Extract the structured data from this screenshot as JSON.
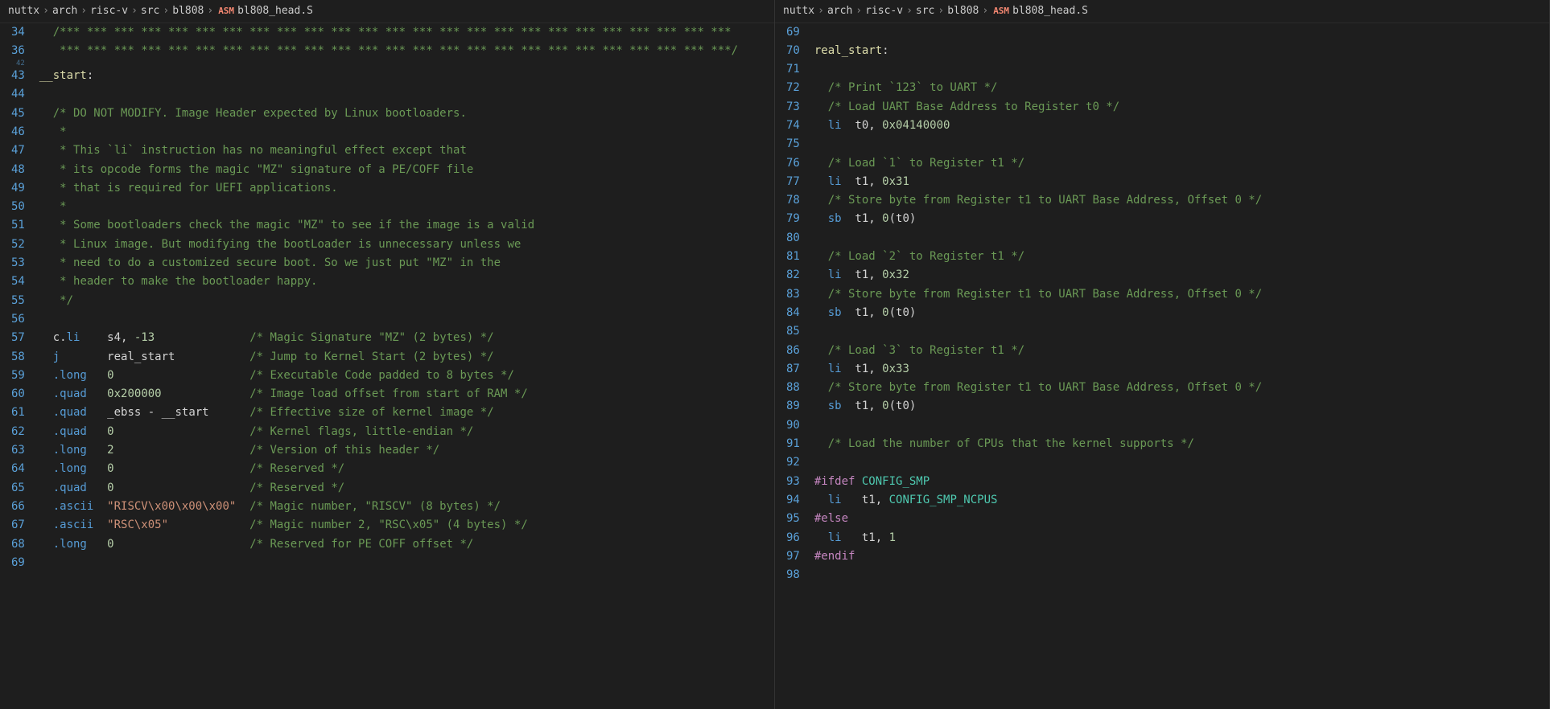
{
  "breadcrumbs": {
    "segments": [
      "nuttx",
      "arch",
      "risc-v",
      "src",
      "bl808"
    ],
    "file": "bl808_head.S",
    "icon_label": "ASM"
  },
  "left_editor": {
    "lines": [
      {
        "num": 34,
        "tokens": [
          {
            "c": "tk-comment",
            "pre": "  ",
            "t": "/*** *** *** *** *** *** *** *** *** *** *** *** *** *** *** *** *** *** *** *** *** *** *** *** ***"
          }
        ]
      },
      {
        "num": 36,
        "tokens": [
          {
            "c": "tk-comment",
            "pre": "   ",
            "t": "*** *** *** *** *** *** *** *** *** *** *** *** *** *** *** *** *** *** *** *** *** *** *** *** ***/"
          }
        ]
      },
      {
        "num": 42,
        "folded": true,
        "tokens": []
      },
      {
        "num": 43,
        "tokens": [
          {
            "c": "tk-label",
            "t": "__start"
          },
          {
            "c": "tk-white",
            "t": ":"
          }
        ]
      },
      {
        "num": 44,
        "tokens": []
      },
      {
        "num": 45,
        "tokens": [
          {
            "c": "tk-comment",
            "pre": "  ",
            "t": "/* DO NOT MODIFY. Image Header expected by Linux bootloaders."
          }
        ]
      },
      {
        "num": 46,
        "tokens": [
          {
            "c": "tk-comment",
            "pre": "   ",
            "t": "*"
          }
        ]
      },
      {
        "num": 47,
        "tokens": [
          {
            "c": "tk-comment",
            "pre": "   ",
            "t": "* This `li` instruction has no meaningful effect except that"
          }
        ]
      },
      {
        "num": 48,
        "tokens": [
          {
            "c": "tk-comment",
            "pre": "   ",
            "t": "* its opcode forms the magic \"MZ\" signature of a PE/COFF file"
          }
        ]
      },
      {
        "num": 49,
        "tokens": [
          {
            "c": "tk-comment",
            "pre": "   ",
            "t": "* that is required for UEFI applications."
          }
        ]
      },
      {
        "num": 50,
        "tokens": [
          {
            "c": "tk-comment",
            "pre": "   ",
            "t": "*"
          }
        ]
      },
      {
        "num": 51,
        "tokens": [
          {
            "c": "tk-comment",
            "pre": "   ",
            "t": "* Some bootloaders check the magic \"MZ\" to see if the image is a valid"
          }
        ]
      },
      {
        "num": 52,
        "tokens": [
          {
            "c": "tk-comment",
            "pre": "   ",
            "t": "* Linux image. But modifying the bootLoader is unnecessary unless we"
          }
        ]
      },
      {
        "num": 53,
        "tokens": [
          {
            "c": "tk-comment",
            "pre": "   ",
            "t": "* need to do a customized secure boot. So we just put \"MZ\" in the"
          }
        ]
      },
      {
        "num": 54,
        "tokens": [
          {
            "c": "tk-comment",
            "pre": "   ",
            "t": "* header to make the bootloader happy."
          }
        ]
      },
      {
        "num": 55,
        "tokens": [
          {
            "c": "tk-comment",
            "pre": "   ",
            "t": "*/"
          }
        ]
      },
      {
        "num": 56,
        "tokens": []
      },
      {
        "num": 57,
        "tokens": [
          {
            "c": "tk-white",
            "pre": "  ",
            "t": "c."
          },
          {
            "c": "tk-key",
            "t": "li"
          },
          {
            "c": "tk-white",
            "t": "    s4, "
          },
          {
            "c": "tk-num",
            "t": "-13"
          },
          {
            "c": "tk-comment",
            "pre": "              ",
            "t": "/* Magic Signature \"MZ\" (2 bytes) */"
          }
        ]
      },
      {
        "num": 58,
        "tokens": [
          {
            "c": "tk-key",
            "pre": "  ",
            "t": "j"
          },
          {
            "c": "tk-white",
            "t": "       real_start"
          },
          {
            "c": "tk-comment",
            "pre": "           ",
            "t": "/* Jump to Kernel Start (2 bytes) */"
          }
        ]
      },
      {
        "num": 59,
        "tokens": [
          {
            "c": "tk-key",
            "pre": "  ",
            "t": ".long"
          },
          {
            "c": "tk-num",
            "pre": "   ",
            "t": "0"
          },
          {
            "c": "tk-comment",
            "pre": "                    ",
            "t": "/* Executable Code padded to 8 bytes */"
          }
        ]
      },
      {
        "num": 60,
        "tokens": [
          {
            "c": "tk-key",
            "pre": "  ",
            "t": ".quad"
          },
          {
            "c": "tk-num",
            "pre": "   ",
            "t": "0x200000"
          },
          {
            "c": "tk-comment",
            "pre": "             ",
            "t": "/* Image load offset from start of RAM */"
          }
        ]
      },
      {
        "num": 61,
        "tokens": [
          {
            "c": "tk-key",
            "pre": "  ",
            "t": ".quad"
          },
          {
            "c": "tk-white",
            "pre": "   ",
            "t": "_ebss - __start"
          },
          {
            "c": "tk-comment",
            "pre": "      ",
            "t": "/* Effective size of kernel image */"
          }
        ]
      },
      {
        "num": 62,
        "tokens": [
          {
            "c": "tk-key",
            "pre": "  ",
            "t": ".quad"
          },
          {
            "c": "tk-num",
            "pre": "   ",
            "t": "0"
          },
          {
            "c": "tk-comment",
            "pre": "                    ",
            "t": "/* Kernel flags, little-endian */"
          }
        ]
      },
      {
        "num": 63,
        "tokens": [
          {
            "c": "tk-key",
            "pre": "  ",
            "t": ".long"
          },
          {
            "c": "tk-num",
            "pre": "   ",
            "t": "2"
          },
          {
            "c": "tk-comment",
            "pre": "                    ",
            "t": "/* Version of this header */"
          }
        ]
      },
      {
        "num": 64,
        "tokens": [
          {
            "c": "tk-key",
            "pre": "  ",
            "t": ".long"
          },
          {
            "c": "tk-num",
            "pre": "   ",
            "t": "0"
          },
          {
            "c": "tk-comment",
            "pre": "                    ",
            "t": "/* Reserved */"
          }
        ]
      },
      {
        "num": 65,
        "tokens": [
          {
            "c": "tk-key",
            "pre": "  ",
            "t": ".quad"
          },
          {
            "c": "tk-num",
            "pre": "   ",
            "t": "0"
          },
          {
            "c": "tk-comment",
            "pre": "                    ",
            "t": "/* Reserved */"
          }
        ]
      },
      {
        "num": 66,
        "tokens": [
          {
            "c": "tk-key",
            "pre": "  ",
            "t": ".ascii"
          },
          {
            "c": "tk-str",
            "pre": "  ",
            "t": "\"RISCV\\x00\\x00\\x00\""
          },
          {
            "c": "tk-comment",
            "pre": "  ",
            "t": "/* Magic number, \"RISCV\" (8 bytes) */"
          }
        ]
      },
      {
        "num": 67,
        "tokens": [
          {
            "c": "tk-key",
            "pre": "  ",
            "t": ".ascii"
          },
          {
            "c": "tk-str",
            "pre": "  ",
            "t": "\"RSC\\x05\""
          },
          {
            "c": "tk-comment",
            "pre": "            ",
            "t": "/* Magic number 2, \"RSC\\x05\" (4 bytes) */"
          }
        ]
      },
      {
        "num": 68,
        "tokens": [
          {
            "c": "tk-key",
            "pre": "  ",
            "t": ".long"
          },
          {
            "c": "tk-num",
            "pre": "   ",
            "t": "0"
          },
          {
            "c": "tk-comment",
            "pre": "                    ",
            "t": "/* Reserved for PE COFF offset */"
          }
        ]
      },
      {
        "num": 69,
        "tokens": []
      }
    ]
  },
  "right_editor": {
    "lines": [
      {
        "num": 69,
        "tokens": []
      },
      {
        "num": 70,
        "tokens": [
          {
            "c": "tk-label",
            "t": "real_start"
          },
          {
            "c": "tk-white",
            "t": ":"
          }
        ]
      },
      {
        "num": 71,
        "tokens": []
      },
      {
        "num": 72,
        "tokens": [
          {
            "c": "tk-comment",
            "pre": "  ",
            "t": "/* Print `123` to UART */"
          }
        ]
      },
      {
        "num": 73,
        "tokens": [
          {
            "c": "tk-comment",
            "pre": "  ",
            "t": "/* Load UART Base Address to Register t0 */"
          }
        ]
      },
      {
        "num": 74,
        "tokens": [
          {
            "c": "tk-key",
            "pre": "  ",
            "t": "li"
          },
          {
            "c": "tk-white",
            "t": "  t0, "
          },
          {
            "c": "tk-num",
            "t": "0x04140000"
          }
        ]
      },
      {
        "num": 75,
        "tokens": []
      },
      {
        "num": 76,
        "tokens": [
          {
            "c": "tk-comment",
            "pre": "  ",
            "t": "/* Load `1` to Register t1 */"
          }
        ]
      },
      {
        "num": 77,
        "tokens": [
          {
            "c": "tk-key",
            "pre": "  ",
            "t": "li"
          },
          {
            "c": "tk-white",
            "t": "  t1, "
          },
          {
            "c": "tk-num",
            "t": "0x31"
          }
        ]
      },
      {
        "num": 78,
        "tokens": [
          {
            "c": "tk-comment",
            "pre": "  ",
            "t": "/* Store byte from Register t1 to UART Base Address, Offset 0 */"
          }
        ]
      },
      {
        "num": 79,
        "tokens": [
          {
            "c": "tk-key",
            "pre": "  ",
            "t": "sb"
          },
          {
            "c": "tk-white",
            "t": "  t1, "
          },
          {
            "c": "tk-num",
            "t": "0"
          },
          {
            "c": "tk-white",
            "t": "(t0)"
          }
        ]
      },
      {
        "num": 80,
        "tokens": []
      },
      {
        "num": 81,
        "tokens": [
          {
            "c": "tk-comment",
            "pre": "  ",
            "t": "/* Load `2` to Register t1 */"
          }
        ]
      },
      {
        "num": 82,
        "tokens": [
          {
            "c": "tk-key",
            "pre": "  ",
            "t": "li"
          },
          {
            "c": "tk-white",
            "t": "  t1, "
          },
          {
            "c": "tk-num",
            "t": "0x32"
          }
        ]
      },
      {
        "num": 83,
        "tokens": [
          {
            "c": "tk-comment",
            "pre": "  ",
            "t": "/* Store byte from Register t1 to UART Base Address, Offset 0 */"
          }
        ]
      },
      {
        "num": 84,
        "tokens": [
          {
            "c": "tk-key",
            "pre": "  ",
            "t": "sb"
          },
          {
            "c": "tk-white",
            "t": "  t1, "
          },
          {
            "c": "tk-num",
            "t": "0"
          },
          {
            "c": "tk-white",
            "t": "(t0)"
          }
        ]
      },
      {
        "num": 85,
        "tokens": []
      },
      {
        "num": 86,
        "tokens": [
          {
            "c": "tk-comment",
            "pre": "  ",
            "t": "/* Load `3` to Register t1 */"
          }
        ]
      },
      {
        "num": 87,
        "tokens": [
          {
            "c": "tk-key",
            "pre": "  ",
            "t": "li"
          },
          {
            "c": "tk-white",
            "t": "  t1, "
          },
          {
            "c": "tk-num",
            "t": "0x33"
          }
        ]
      },
      {
        "num": 88,
        "tokens": [
          {
            "c": "tk-comment",
            "pre": "  ",
            "t": "/* Store byte from Register t1 to UART Base Address, Offset 0 */"
          }
        ]
      },
      {
        "num": 89,
        "tokens": [
          {
            "c": "tk-key",
            "pre": "  ",
            "t": "sb"
          },
          {
            "c": "tk-white",
            "t": "  t1, "
          },
          {
            "c": "tk-num",
            "t": "0"
          },
          {
            "c": "tk-white",
            "t": "(t0)"
          }
        ]
      },
      {
        "num": 90,
        "tokens": []
      },
      {
        "num": 91,
        "tokens": [
          {
            "c": "tk-comment",
            "pre": "  ",
            "t": "/* Load the number of CPUs that the kernel supports */"
          }
        ]
      },
      {
        "num": 92,
        "tokens": []
      },
      {
        "num": 93,
        "tokens": [
          {
            "c": "tk-macro",
            "t": "#ifdef"
          },
          {
            "c": "tk-const",
            "pre": " ",
            "t": "CONFIG_SMP"
          }
        ]
      },
      {
        "num": 94,
        "tokens": [
          {
            "c": "tk-key",
            "pre": "  ",
            "t": "li"
          },
          {
            "c": "tk-white",
            "t": "   t1, "
          },
          {
            "c": "tk-const",
            "t": "CONFIG_SMP_NCPUS"
          }
        ]
      },
      {
        "num": 95,
        "tokens": [
          {
            "c": "tk-macro",
            "t": "#else"
          }
        ]
      },
      {
        "num": 96,
        "tokens": [
          {
            "c": "tk-key",
            "pre": "  ",
            "t": "li"
          },
          {
            "c": "tk-white",
            "t": "   t1, "
          },
          {
            "c": "tk-num",
            "t": "1"
          }
        ]
      },
      {
        "num": 97,
        "tokens": [
          {
            "c": "tk-macro",
            "t": "#endif"
          }
        ]
      },
      {
        "num": 98,
        "tokens": []
      }
    ]
  }
}
